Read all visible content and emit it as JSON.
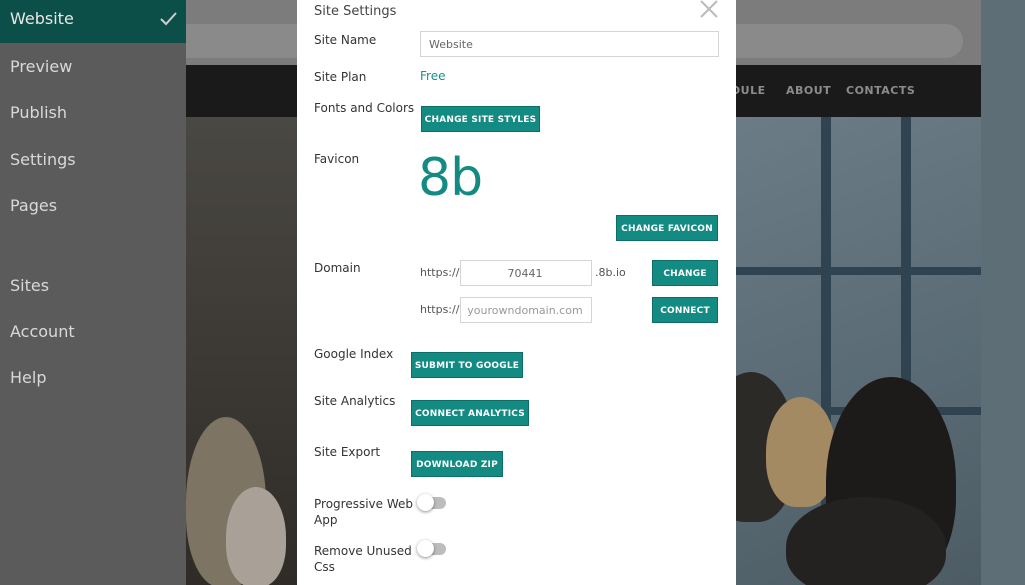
{
  "sidebar": {
    "items": [
      {
        "label": "Website",
        "active": true
      },
      {
        "label": "Preview"
      },
      {
        "label": "Publish"
      },
      {
        "label": "Settings"
      },
      {
        "label": "Pages"
      },
      {
        "label": "Sites"
      },
      {
        "label": "Account"
      },
      {
        "label": "Help"
      }
    ]
  },
  "site_nav": {
    "links": [
      "DULE",
      "ABOUT",
      "CONTACTS"
    ]
  },
  "modal": {
    "title": "Site Settings",
    "site_name": {
      "label": "Site Name",
      "value": "Website"
    },
    "site_plan": {
      "label": "Site Plan",
      "value": "Free"
    },
    "fonts_colors": {
      "label": "Fonts and Colors",
      "button": "CHANGE SITE STYLES"
    },
    "favicon": {
      "label": "Favicon",
      "preview": "8b",
      "button": "CHANGE FAVICON"
    },
    "domain": {
      "label": "Domain",
      "prefix": "https://",
      "subdomain_value": "70441",
      "suffix": ".8b.io",
      "change_button": "CHANGE",
      "custom_prefix": "https://",
      "custom_placeholder": "yourowndomain.com",
      "connect_button": "CONNECT"
    },
    "google_index": {
      "label": "Google Index",
      "button": "SUBMIT TO GOOGLE"
    },
    "site_analytics": {
      "label": "Site Analytics",
      "button": "CONNECT ANALYTICS"
    },
    "site_export": {
      "label": "Site Export",
      "button": "DOWNLOAD ZIP"
    },
    "pwa": {
      "label_line1": "Progressive Web",
      "label_line2": "App",
      "enabled": false
    },
    "remove_css": {
      "label_line1": "Remove Unused",
      "label_line2": "Css",
      "enabled": false
    }
  },
  "colors": {
    "accent": "#138a82",
    "sidebar_active": "#0c4f49",
    "sidebar_bg": "#5b5b5b"
  }
}
